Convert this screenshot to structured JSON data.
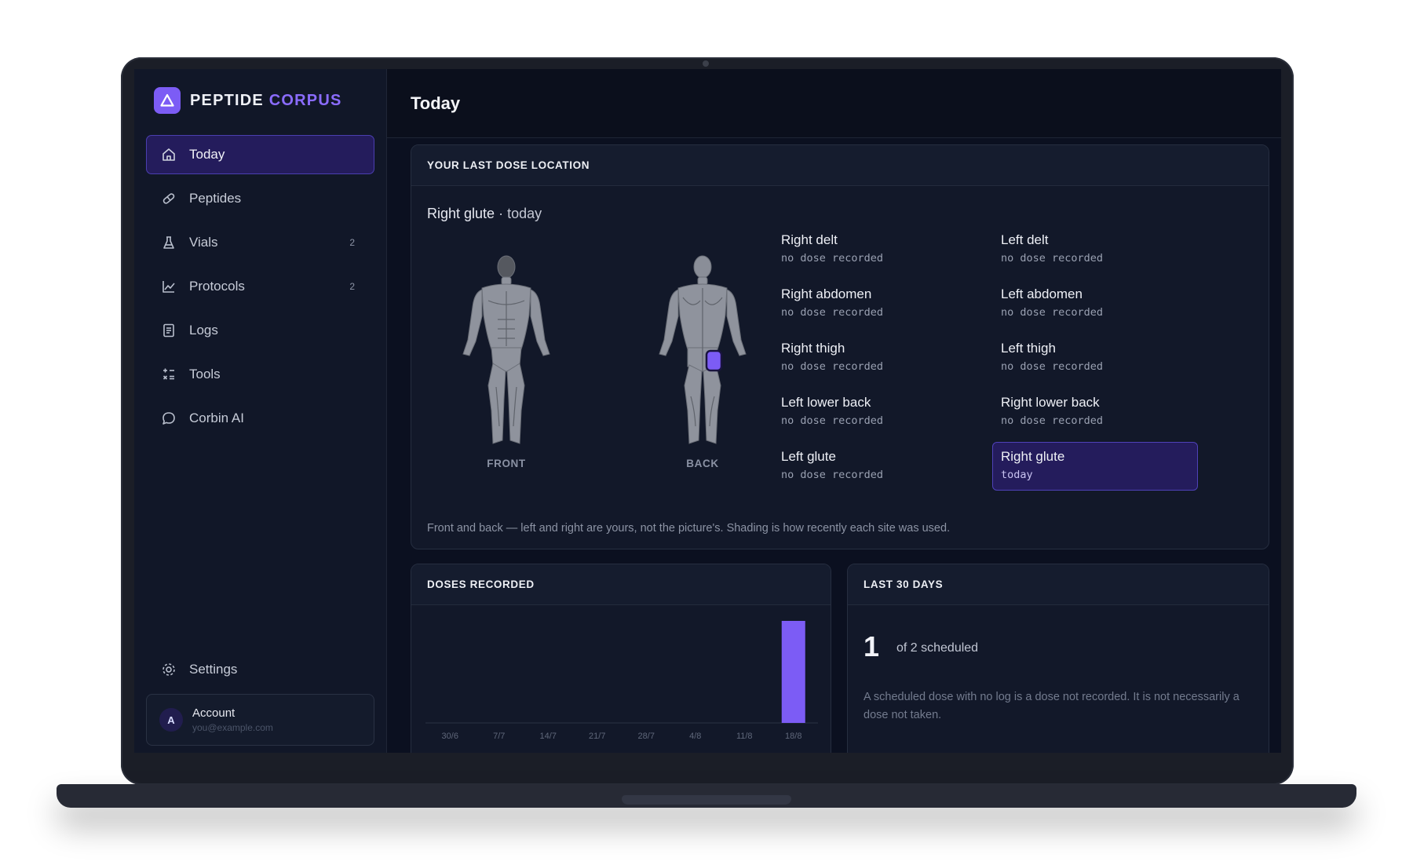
{
  "app": {
    "brand_primary": "PEPTIDE",
    "brand_accent": "CORPUS",
    "accent_color": "#7c5cf5"
  },
  "sidebar": {
    "items": [
      {
        "label": "Today",
        "icon": "home-icon",
        "active": true,
        "badge": ""
      },
      {
        "label": "Peptides",
        "icon": "pill-icon",
        "active": false,
        "badge": ""
      },
      {
        "label": "Vials",
        "icon": "flask-icon",
        "active": false,
        "badge": "2"
      },
      {
        "label": "Protocols",
        "icon": "line-chart-icon",
        "active": false,
        "badge": "2"
      },
      {
        "label": "Logs",
        "icon": "document-icon",
        "active": false,
        "badge": ""
      },
      {
        "label": "Tools",
        "icon": "calculator-icon",
        "active": false,
        "badge": ""
      },
      {
        "label": "Corbin AI",
        "icon": "chat-bubble-icon",
        "active": false,
        "badge": ""
      }
    ],
    "settings_label": "Settings",
    "account": {
      "avatar_letter": "A",
      "name": "Account",
      "email": "you@example.com"
    }
  },
  "header": {
    "title": "Today"
  },
  "dose_location": {
    "title": "YOUR LAST DOSE LOCATION",
    "site": "Right glute",
    "separator": "·",
    "when": "today",
    "front_label": "FRONT",
    "back_label": "BACK",
    "sites": [
      {
        "name": "Right delt",
        "status": "no dose recorded",
        "selected": false
      },
      {
        "name": "Left delt",
        "status": "no dose recorded",
        "selected": false
      },
      {
        "name": "Right abdomen",
        "status": "no dose recorded",
        "selected": false
      },
      {
        "name": "Left abdomen",
        "status": "no dose recorded",
        "selected": false
      },
      {
        "name": "Right thigh",
        "status": "no dose recorded",
        "selected": false
      },
      {
        "name": "Left thigh",
        "status": "no dose recorded",
        "selected": false
      },
      {
        "name": "Left lower back",
        "status": "no dose recorded",
        "selected": false
      },
      {
        "name": "Right lower back",
        "status": "no dose recorded",
        "selected": false
      },
      {
        "name": "Left glute",
        "status": "no dose recorded",
        "selected": false
      },
      {
        "name": "Right glute",
        "status": "today",
        "selected": true
      }
    ],
    "note": "Front and back — left and right are yours, not the picture's. Shading is how recently each site was used."
  },
  "doses_recorded": {
    "title": "DOSES RECORDED",
    "chart_data": {
      "type": "bar",
      "categories": [
        "30/6",
        "7/7",
        "14/7",
        "21/7",
        "28/7",
        "4/8",
        "11/8",
        "18/8"
      ],
      "values": [
        0,
        0,
        0,
        0,
        0,
        0,
        0,
        1
      ],
      "ylim": [
        0,
        1
      ],
      "bar_color": "#7c5cf5",
      "grid": false
    }
  },
  "last_30_days": {
    "title": "LAST 30 DAYS",
    "count": "1",
    "sub": "of 2 scheduled",
    "note": "A scheduled dose with no log is a dose not recorded. It is not necessarily a dose not taken."
  }
}
